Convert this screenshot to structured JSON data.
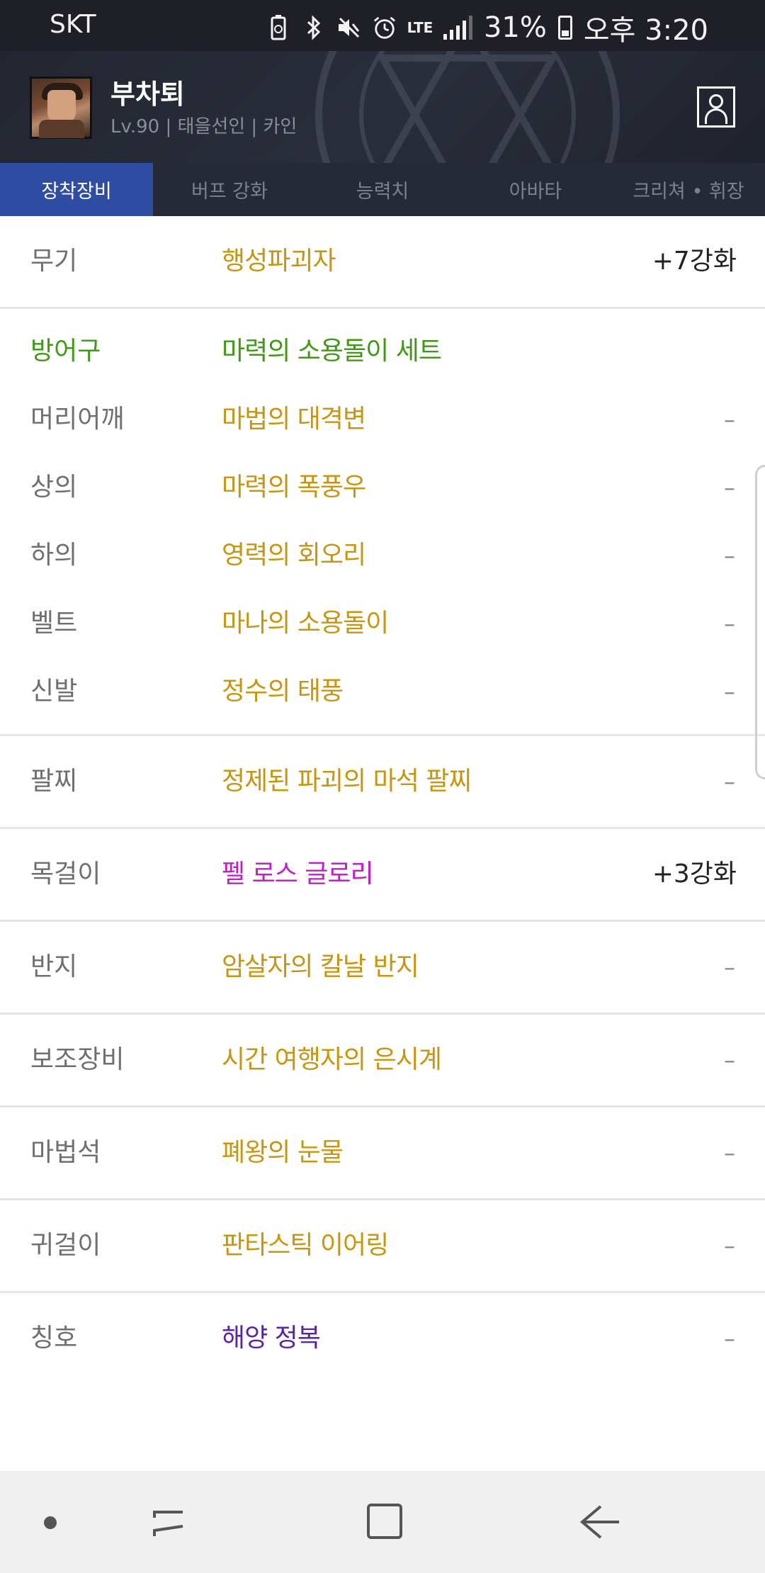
{
  "statusbar": {
    "carrier": "SKT",
    "network": "LTE",
    "battery": "31%",
    "time": "오후 3:20",
    "icons": [
      "battery-saver-icon",
      "bluetooth-icon",
      "mute-icon",
      "alarm-icon",
      "lte-icon",
      "signal-icon",
      "battery-icon"
    ]
  },
  "header": {
    "name": "부차퇴",
    "info": "Lv.90 | 태을선인 | 카인"
  },
  "tabs": [
    {
      "label": "장착장비",
      "active": true
    },
    {
      "label": "버프 강화",
      "active": false
    },
    {
      "label": "능력치",
      "active": false
    },
    {
      "label": "아바타",
      "active": false
    },
    {
      "label": "크리쳐 • 휘장",
      "active": false
    }
  ],
  "equipment": {
    "weapon": {
      "label": "무기",
      "item": "행성파괴자",
      "enhance": "+7강화"
    },
    "armor_set": {
      "label": "방어구",
      "item": "마력의 소용돌이 세트"
    },
    "armor": [
      {
        "label": "머리어깨",
        "item": "마법의 대격변",
        "enhance": "–"
      },
      {
        "label": "상의",
        "item": "마력의 폭풍우",
        "enhance": "–"
      },
      {
        "label": "하의",
        "item": "영력의 회오리",
        "enhance": "–"
      },
      {
        "label": "벨트",
        "item": "마나의 소용돌이",
        "enhance": "–"
      },
      {
        "label": "신발",
        "item": "정수의 태풍",
        "enhance": "–"
      }
    ],
    "bracelet": {
      "label": "팔찌",
      "item": "정제된 파괴의 마석 팔찌",
      "enhance": "–"
    },
    "necklace": {
      "label": "목걸이",
      "item": "펠 로스 글로리",
      "enhance": "+3강화"
    },
    "ring": {
      "label": "반지",
      "item": "암살자의 칼날 반지",
      "enhance": "–"
    },
    "support": {
      "label": "보조장비",
      "item": "시간 여행자의 은시계",
      "enhance": "–"
    },
    "magic_stone": {
      "label": "마법석",
      "item": "폐왕의 눈물",
      "enhance": "–"
    },
    "earring": {
      "label": "귀걸이",
      "item": "판타스틱 이어링",
      "enhance": "–"
    },
    "title": {
      "label": "칭호",
      "item": "해양 정복",
      "enhance": "–"
    }
  },
  "colors": {
    "tab_active": "#2f4da3",
    "item_unique": "#c8950f",
    "set_green": "#3d9a12",
    "legendary_pink": "#c21ec9",
    "title_purple": "#5a24a8"
  }
}
